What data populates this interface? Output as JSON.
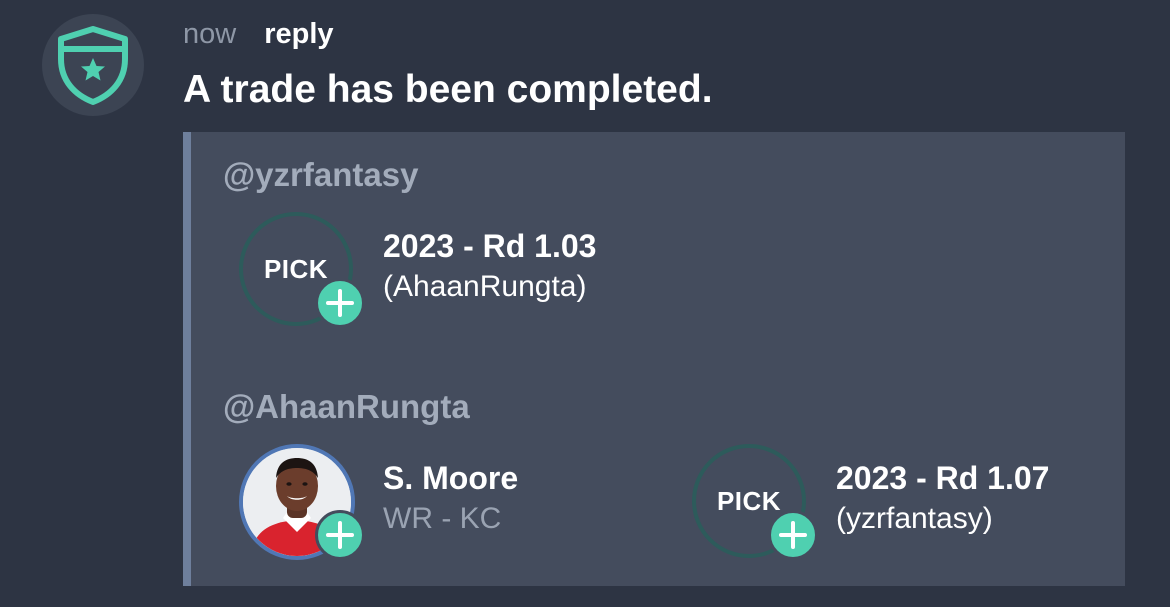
{
  "message": {
    "timestamp": "now",
    "reply_label": "reply",
    "headline": "A trade has been completed.",
    "bot_avatar_icon": "shield-star-icon"
  },
  "trade": {
    "parties": [
      {
        "handle": "@yzrfantasy",
        "assets": [
          {
            "icon_label": "PICK",
            "title": "2023 - Rd 1.03",
            "subtitle": "(AhaanRungta)"
          }
        ]
      },
      {
        "handle": "@AhaanRungta",
        "assets": [
          {
            "icon": "player-photo",
            "title": "S. Moore",
            "subtitle": "WR - KC"
          },
          {
            "icon_label": "PICK",
            "title": "2023 - Rd 1.07",
            "subtitle": "(yzrfantasy)"
          }
        ]
      }
    ]
  },
  "colors": {
    "background": "#2d3443",
    "attachment": "#444c5d",
    "accent_bar": "#6e7f9c",
    "add_badge": "#4fd0b0",
    "pick_ring": "#2d5b5b",
    "player_ring": "#5077b5"
  }
}
